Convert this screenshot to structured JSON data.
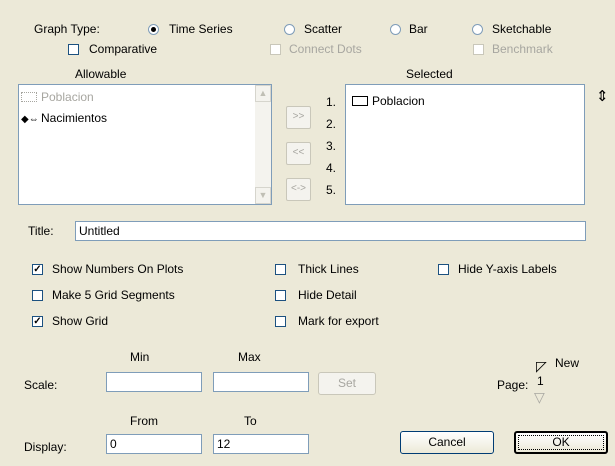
{
  "graph_type": {
    "label": "Graph Type:",
    "options": [
      {
        "label": "Time Series",
        "selected": true
      },
      {
        "label": "Scatter",
        "selected": false
      },
      {
        "label": "Bar",
        "selected": false
      },
      {
        "label": "Sketchable",
        "selected": false
      }
    ]
  },
  "options_row": {
    "comparative": {
      "label": "Comparative",
      "checked": false
    },
    "connect_dots": {
      "label": "Connect Dots",
      "checked": false,
      "disabled": true
    },
    "benchmark": {
      "label": "Benchmark",
      "checked": false,
      "disabled": true
    }
  },
  "allowable": {
    "header": "Allowable",
    "items": [
      {
        "label": "Poblacion",
        "dimmed": true
      },
      {
        "label": "Nacimientos",
        "icon": "arrow-flow-icon"
      }
    ]
  },
  "move_buttons": {
    "add": ">>",
    "remove": "<<",
    "swap": "<->"
  },
  "slots": [
    "1.",
    "2.",
    "3.",
    "4.",
    "5."
  ],
  "selected": {
    "header": "Selected",
    "items": [
      {
        "label": "Poblacion"
      }
    ]
  },
  "title_field": {
    "label": "Title:",
    "value": "Untitled"
  },
  "checkboxes": {
    "show_numbers": {
      "label": "Show Numbers On Plots",
      "checked": true
    },
    "grid_segments": {
      "label": "Make 5 Grid Segments",
      "checked": false
    },
    "show_grid": {
      "label": "Show Grid",
      "checked": true
    },
    "thick_lines": {
      "label": "Thick Lines",
      "checked": false
    },
    "hide_detail": {
      "label": "Hide Detail",
      "checked": false
    },
    "mark_export": {
      "label": "Mark for export",
      "checked": false
    },
    "hide_y_labels": {
      "label": "Hide Y-axis Labels",
      "checked": false
    }
  },
  "scale": {
    "label": "Scale:",
    "min_label": "Min",
    "max_label": "Max",
    "min_value": "",
    "max_value": "",
    "set_label": "Set"
  },
  "display": {
    "label": "Display:",
    "from_label": "From",
    "to_label": "To",
    "from_value": "0",
    "to_value": "12"
  },
  "page": {
    "label": "Page:",
    "value": "1",
    "new_label": "New"
  },
  "buttons": {
    "cancel": "Cancel",
    "ok": "OK"
  }
}
